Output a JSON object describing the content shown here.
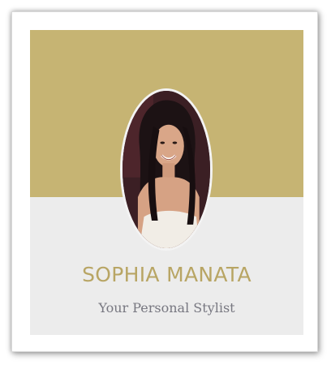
{
  "profile": {
    "name": "SOPHIA MANATA",
    "tagline": "Your Personal Stylist"
  },
  "colors": {
    "banner": "#c6b473",
    "name_text": "#b8a564",
    "tagline_text": "#777780",
    "card_background": "#ececec"
  },
  "icons": {
    "portrait": "profile-photo"
  }
}
